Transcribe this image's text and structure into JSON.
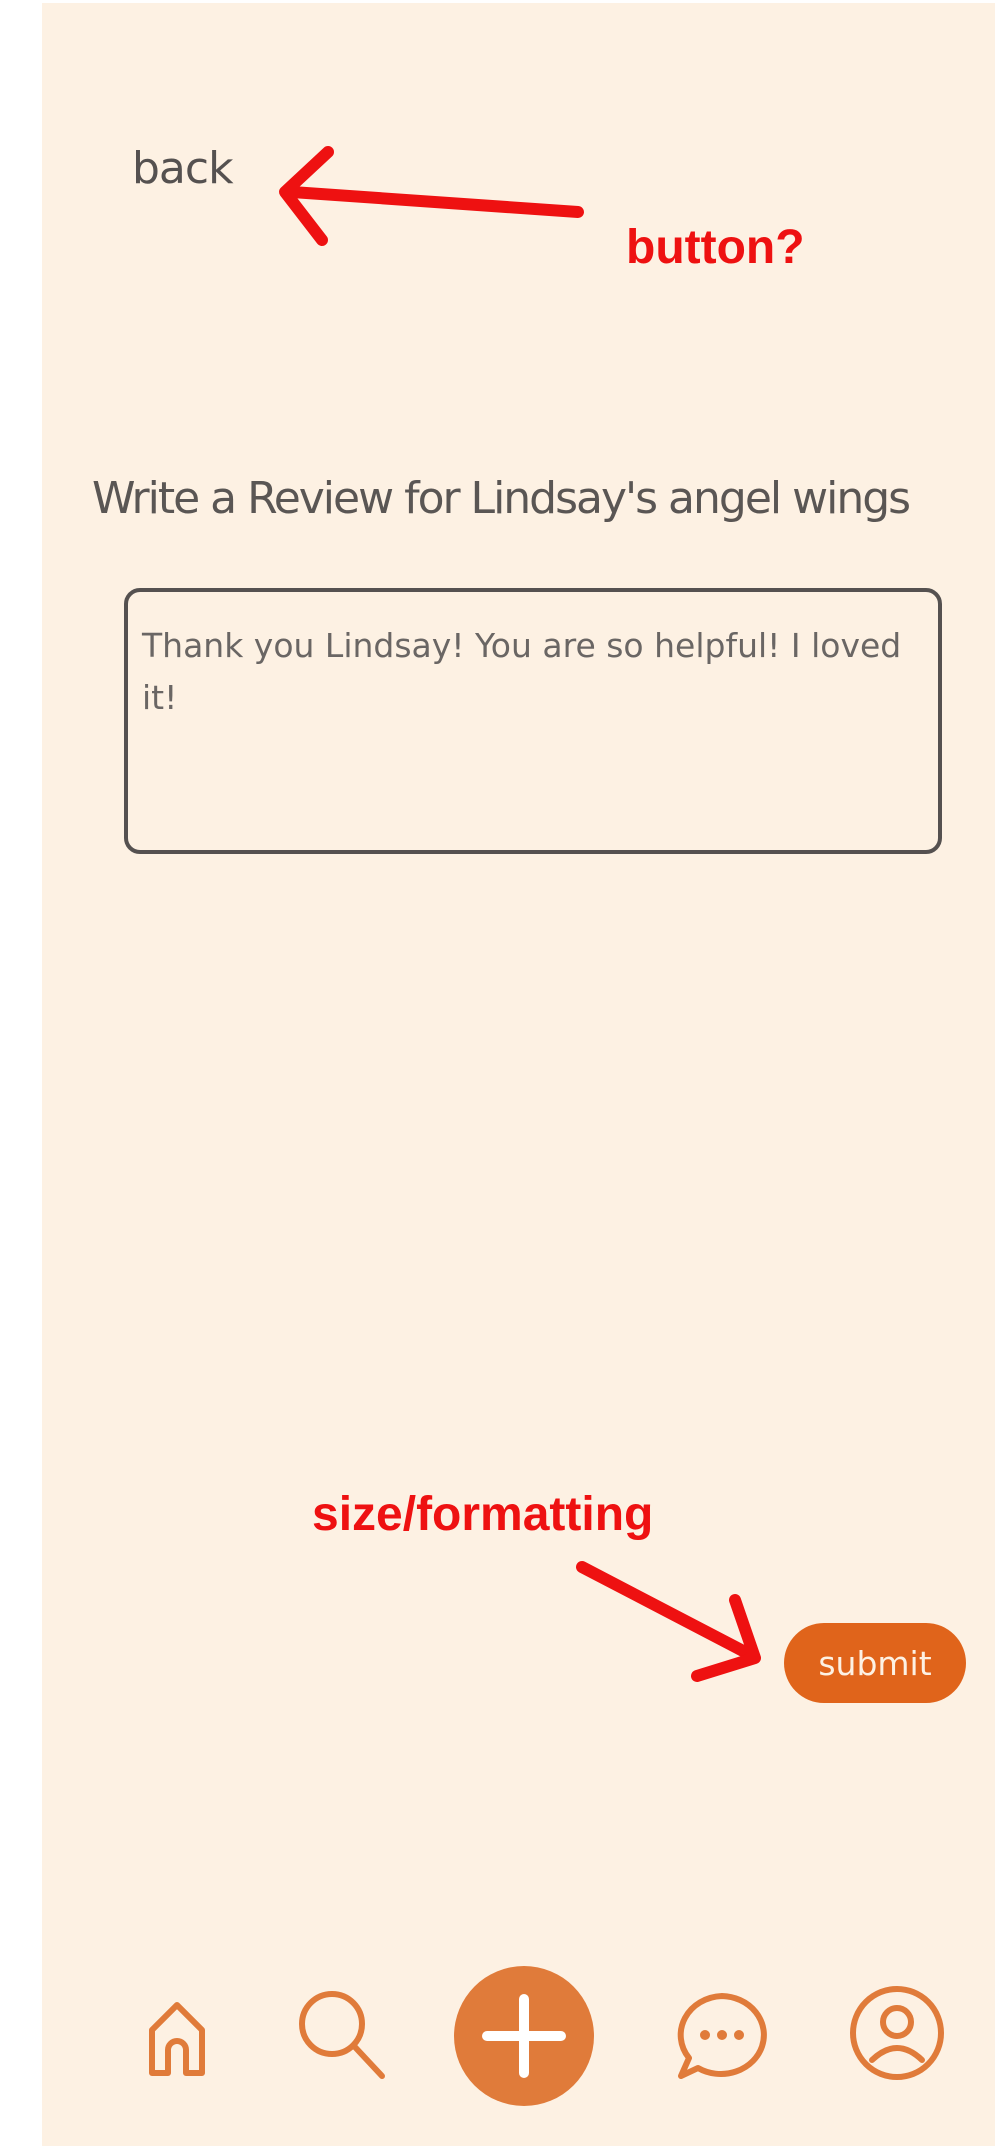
{
  "header": {
    "back_label": "back"
  },
  "main": {
    "title": "Write a Review for Lindsay's angel wings",
    "review_text": "Thank you Lindsay! You are so helpful! I loved it!",
    "submit_label": "submit"
  },
  "bottom_nav": {
    "items": [
      {
        "icon": "home-icon"
      },
      {
        "icon": "search-icon"
      },
      {
        "icon": "add-icon"
      },
      {
        "icon": "chat-icon"
      },
      {
        "icon": "profile-icon"
      }
    ]
  },
  "annotations": {
    "back_note": "button?",
    "submit_note": "size/formatting"
  },
  "colors": {
    "background": "#fdf1e3",
    "accent": "#e0641b",
    "text": "#555150",
    "annotation": "#ee1111"
  }
}
